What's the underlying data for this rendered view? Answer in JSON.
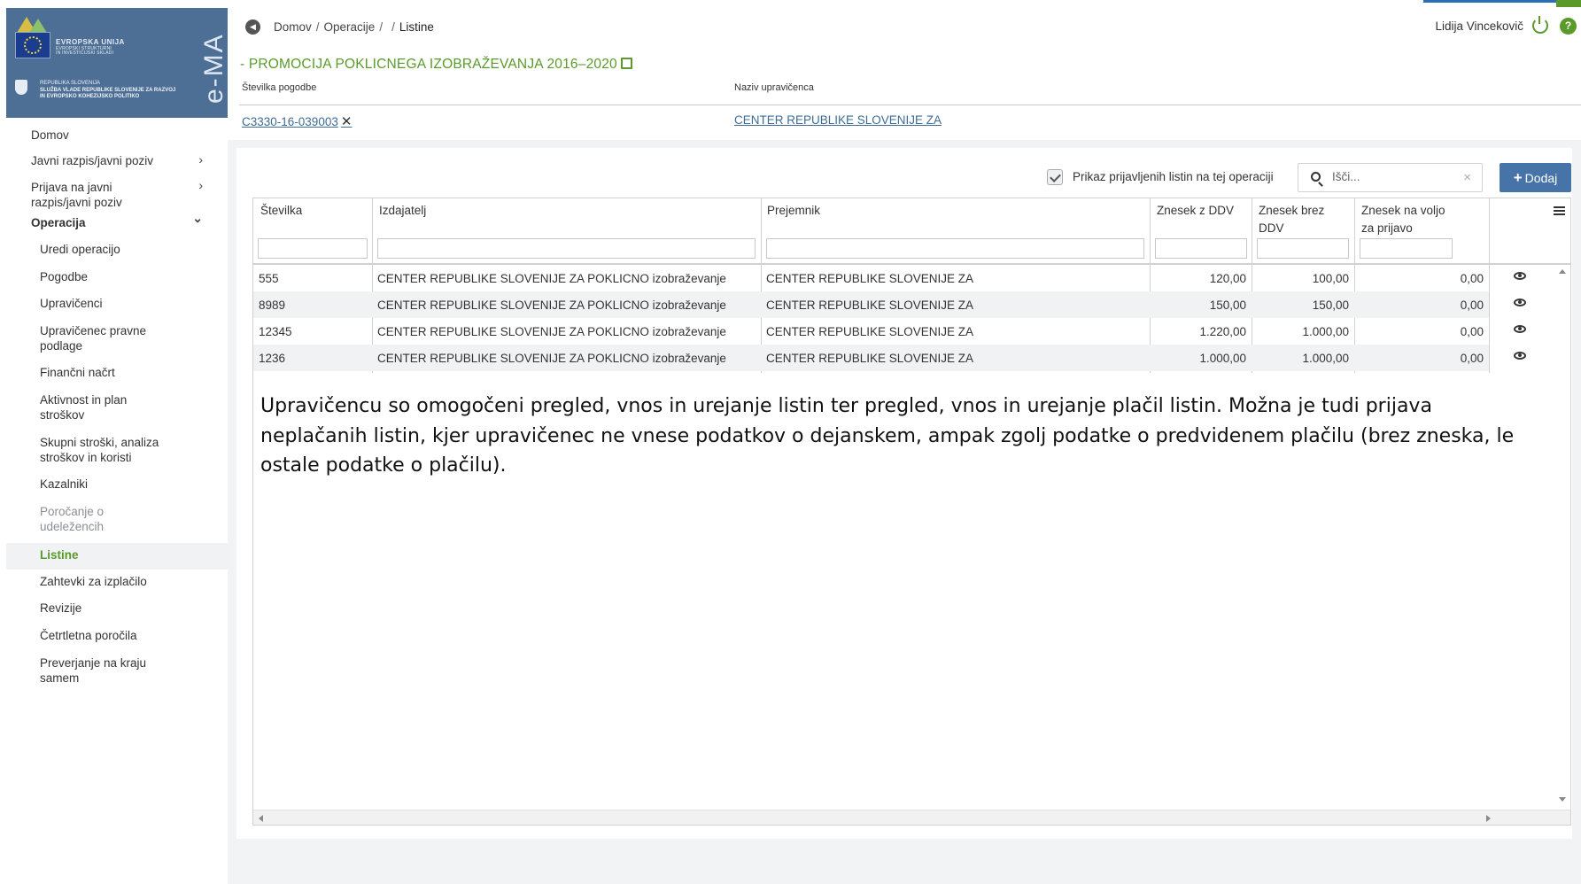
{
  "logo": {
    "eu_title": "EVROPSKA UNIJA",
    "eu_sub1": "EVROPSKI STRUKTURNI",
    "eu_sub2": "IN INVESTICIJSKI SKLADI",
    "gov_line1": "REPUBLIKA SLOVENIJA",
    "gov_line2": "SLUŽBA VLADE REPUBLIKE SLOVENIJE ZA RAZVOJ",
    "gov_line3": "IN EVROPSKO KOHEZIJSKO POLITIKO",
    "app_name": "e-MA"
  },
  "sidebar": {
    "items": [
      {
        "label": "Domov"
      },
      {
        "label": "Javni razpis/javni poziv"
      },
      {
        "label": "Prijava na javni razpis/javni poziv"
      },
      {
        "label": "Operacija"
      },
      {
        "label": "Uredi operacijo"
      },
      {
        "label": "Pogodbe"
      },
      {
        "label": "Upravičenci"
      },
      {
        "label": "Upravičenec pravne podlage"
      },
      {
        "label": "Finančni načrt"
      },
      {
        "label": "Aktivnost in plan stroškov"
      },
      {
        "label": "Skupni stroški, analiza stroškov in koristi"
      },
      {
        "label": "Kazalniki"
      },
      {
        "label": "Poročanje o udeležencih"
      },
      {
        "label": "Listine"
      },
      {
        "label": "Zahtevki za izplačilo"
      },
      {
        "label": "Revizije"
      },
      {
        "label": "Četrtletna poročila"
      },
      {
        "label": "Preverjanje na kraju samem"
      }
    ],
    "chevron_right": "›",
    "chevron_down": "⌄"
  },
  "header": {
    "breadcrumb": [
      "Domov",
      "Operacije",
      "Listine"
    ],
    "sep": "/",
    "user": "Lidija Vincekovič",
    "help": "?"
  },
  "operation": {
    "title": "- PROMOCIJA POKLICNEGA IZOBRAŽEVANJA 2016–2020",
    "contract_label": "Številka pogodbe",
    "contract_value": "C3330-16-039003",
    "recipient_label": "Naziv upravičenca",
    "recipient_value": "CENTER REPUBLIKE SLOVENIJE ZA"
  },
  "toolbar": {
    "checkbox_label": "Prikaz prijavljenih listin na tej operaciji",
    "checkbox_checked": true,
    "search_placeholder": "Išči...",
    "clear": "×",
    "add_label": "Dodaj",
    "add_plus": "+"
  },
  "table": {
    "headers": {
      "stevilka": "Številka",
      "izdajatelj": "Izdajatelj",
      "prejemnik": "Prejemnik",
      "z_ddv": "Znesek z DDV",
      "brez_ddv_1": "Znesek brez",
      "brez_ddv_2": "DDV",
      "voljo_1": "Znesek na voljo",
      "voljo_2": "za prijavo"
    },
    "rows": [
      {
        "stevilka": "555",
        "izdajatelj": "CENTER REPUBLIKE SLOVENIJE ZA POKLICNO izobraževanje",
        "prejemnik": "CENTER REPUBLIKE SLOVENIJE ZA",
        "z_ddv": "120,00",
        "brez_ddv": "100,00",
        "voljo": "0,00"
      },
      {
        "stevilka": "8989",
        "izdajatelj": "CENTER REPUBLIKE SLOVENIJE ZA POKLICNO izobraževanje",
        "prejemnik": "CENTER REPUBLIKE SLOVENIJE ZA",
        "z_ddv": "150,00",
        "brez_ddv": "150,00",
        "voljo": "0,00"
      },
      {
        "stevilka": "12345",
        "izdajatelj": "CENTER REPUBLIKE SLOVENIJE ZA POKLICNO izobraževanje",
        "prejemnik": "CENTER REPUBLIKE SLOVENIJE ZA",
        "z_ddv": "1.220,00",
        "brez_ddv": "1.000,00",
        "voljo": "0,00"
      },
      {
        "stevilka": "1236",
        "izdajatelj": "CENTER REPUBLIKE SLOVENIJE ZA POKLICNO izobraževanje",
        "prejemnik": "CENTER REPUBLIKE SLOVENIJE ZA",
        "z_ddv": "1.000,00",
        "brez_ddv": "1.000,00",
        "voljo": "0,00"
      }
    ]
  },
  "note": "Upravičencu so omogočeni pregled, vnos in urejanje listin ter pregled, vnos in urejanje plačil listin. Možna je tudi prijava neplačanih listin, kjer upravičenec ne vnese podatkov o dejanskem, ampak zgolj podatke o predvidenem plačilu (brez zneska, le ostale podatke o plačilu).",
  "colors": {
    "accent_green": "#5a9a2a",
    "primary_blue": "#4774a8",
    "link_blue": "#3f6c94",
    "logo_bg": "#4d6f95"
  }
}
